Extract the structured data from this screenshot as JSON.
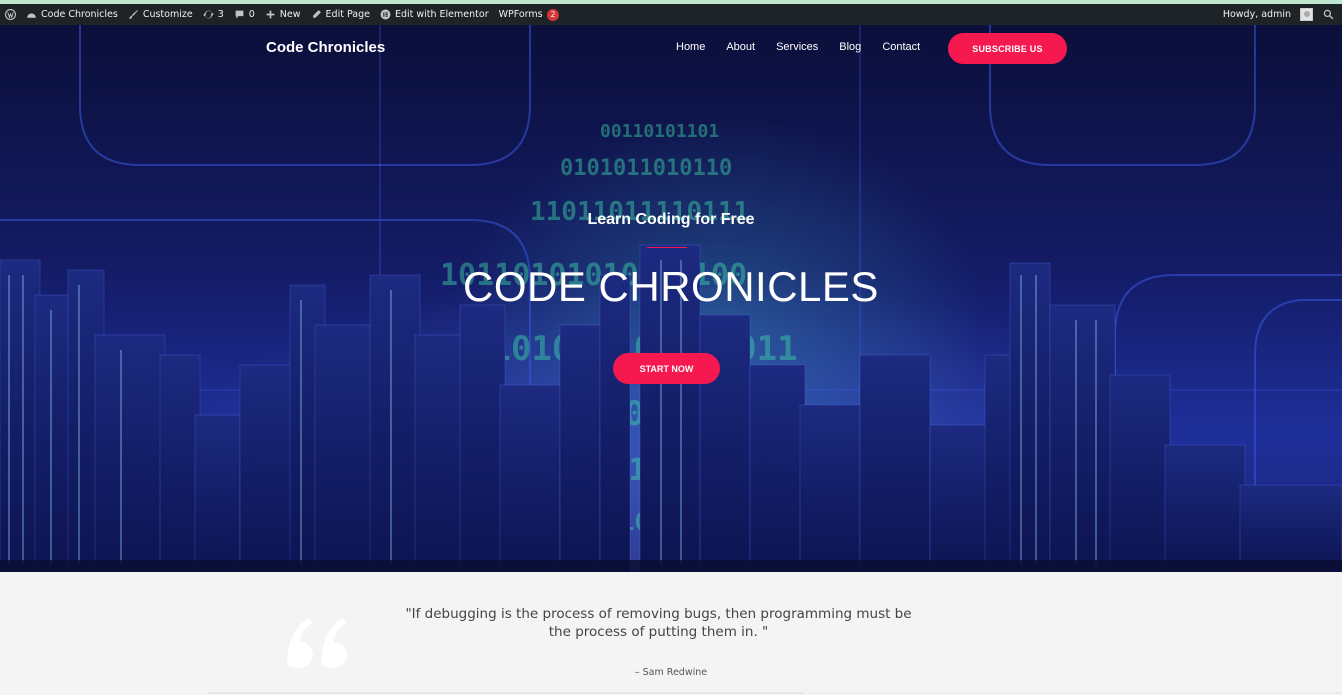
{
  "adminbar": {
    "site": "Code Chronicles",
    "customize": "Customize",
    "updates": "3",
    "comments": "0",
    "new": "New",
    "edit_page": "Edit Page",
    "edit_elementor": "Edit with Elementor",
    "wpforms": "WPForms",
    "wpforms_badge": "2",
    "howdy": "Howdy, admin"
  },
  "nav": {
    "brand": "Code Chronicles",
    "items": [
      "Home",
      "About",
      "Services",
      "Blog",
      "Contact"
    ],
    "subscribe": "SUBSCRIBE US"
  },
  "hero": {
    "eyebrow": "Learn Coding for Free",
    "title": "CODE CHRONICLES",
    "cta": "START NOW"
  },
  "quote": {
    "text": "\"If debugging is the process of removing bugs, then programming must be the process of putting them in. \"",
    "author": "– Sam Redwine"
  },
  "colors": {
    "accent": "#f5194f",
    "adminbar": "#1d2327",
    "hero_dark": "#0b0f3a",
    "hero_blue": "#1e2f9a"
  }
}
